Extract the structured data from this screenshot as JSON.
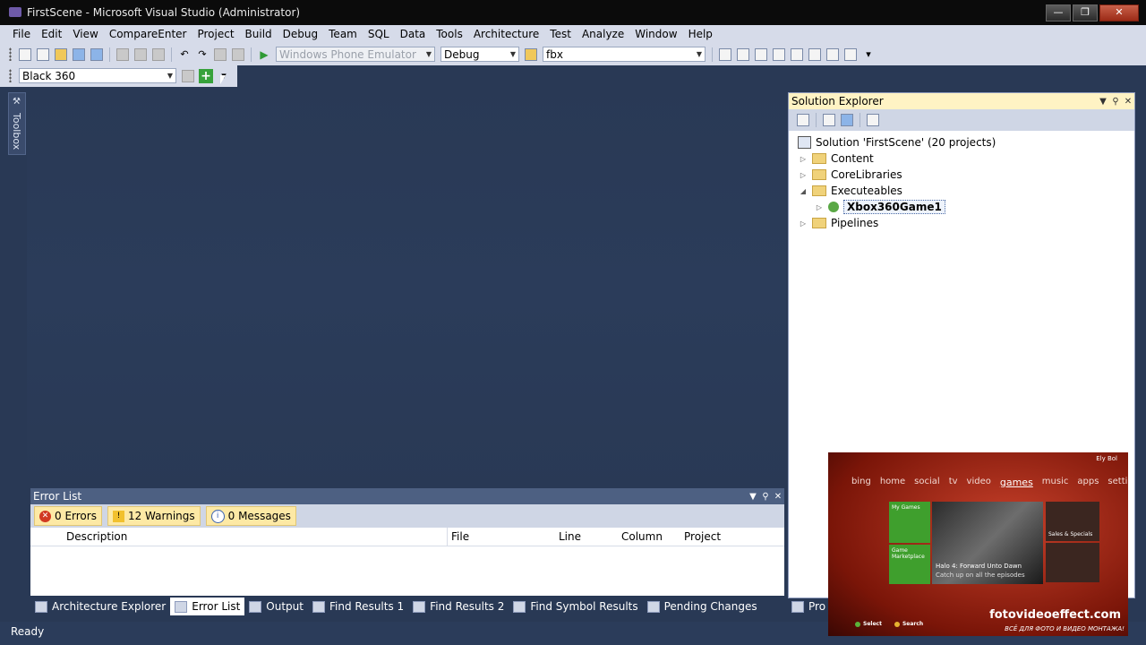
{
  "window": {
    "title": "FirstScene - Microsoft Visual Studio (Administrator)"
  },
  "menu": [
    "File",
    "Edit",
    "View",
    "CompareEnter",
    "Project",
    "Build",
    "Debug",
    "Team",
    "SQL",
    "Data",
    "Tools",
    "Architecture",
    "Test",
    "Analyze",
    "Window",
    "Help"
  ],
  "toolbar": {
    "target_device": "Windows Phone Emulator",
    "configuration": "Debug",
    "find_text": "fbx",
    "xbox_device": "Black 360"
  },
  "toolbox": {
    "label": "Toolbox"
  },
  "solution_explorer": {
    "title": "Solution Explorer",
    "solution": "Solution 'FirstScene' (20 projects)",
    "items": [
      {
        "label": "Content"
      },
      {
        "label": "CoreLibraries"
      },
      {
        "label": "Executeables"
      },
      {
        "label": "Xbox360Game1"
      },
      {
        "label": "Pipelines"
      }
    ]
  },
  "error_list": {
    "title": "Error List",
    "errors": "0 Errors",
    "warnings": "12 Warnings",
    "messages": "0 Messages",
    "columns": [
      "Description",
      "File",
      "Line",
      "Column",
      "Project"
    ]
  },
  "bottom_tabs": [
    "Architecture Explorer",
    "Error List",
    "Output",
    "Find Results 1",
    "Find Results 2",
    "Find Symbol Results",
    "Pending Changes"
  ],
  "pro_tab": "Pro",
  "status": "Ready",
  "xbox": {
    "user": "Ely Bol",
    "nav": [
      "bing",
      "home",
      "social",
      "tv",
      "video",
      "games",
      "music",
      "apps",
      "settings"
    ],
    "tile_my_games": "My Games",
    "tile_game_marketplace": "Game Marketplace",
    "hero_title": "Halo 4: Forward Unto Dawn",
    "hero_sub": "Catch up on all the episodes",
    "tile_sales": "Sales & Specials",
    "select": "Select",
    "search": "Search",
    "watermark": "fotovideoeffect.com",
    "watermark_sub": "ВСЁ ДЛЯ ФОТО И ВИДЕО МОНТАЖА!"
  }
}
